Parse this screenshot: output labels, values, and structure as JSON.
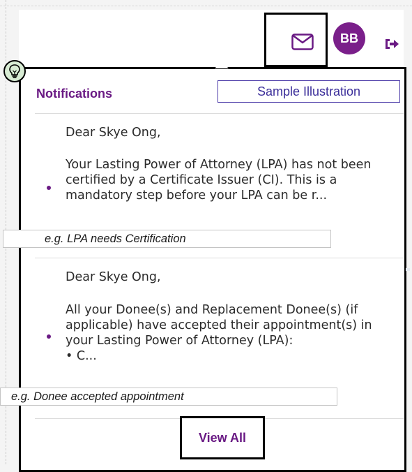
{
  "header": {
    "mail_icon": "mail-icon",
    "avatar_initials": "BB",
    "logout_icon": "logout-icon",
    "avatar_color": "#7a1f8a"
  },
  "annotations": {
    "bulb_icon": "lightbulb-icon",
    "sample_label": "Sample Illustration",
    "example_1": "e.g. LPA needs Certification",
    "example_2": "e.g. Donee accepted appointment"
  },
  "notifications": {
    "title": "Notifications",
    "accent": "#6a1a84",
    "items": [
      {
        "greeting": "Dear Skye Ong,",
        "body": "Your Lasting Power of Attorney (LPA) has not been certified by a Certificate Issuer (CI). This is a mandatory step before your LPA can be r..."
      },
      {
        "greeting": "Dear Skye Ong,",
        "body": "All your Donee(s) and Replacement Donee(s) (if applicable) have accepted their appointment(s) in your Lasting Power of Attorney (LPA):\n• C..."
      }
    ],
    "view_all_label": "View All"
  }
}
